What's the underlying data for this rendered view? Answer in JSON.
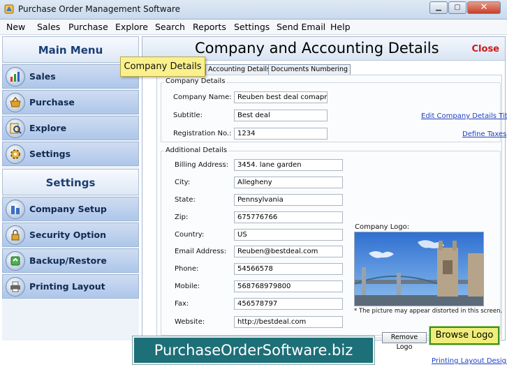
{
  "window": {
    "title": "Purchase Order Management Software",
    "min_glyph": "▁",
    "max_glyph": "▢",
    "close_glyph": "✕"
  },
  "menu": [
    "New",
    "Sales",
    "Purchase",
    "Explore",
    "Search",
    "Reports",
    "Settings",
    "Send Email",
    "Help"
  ],
  "sidebar": {
    "main_menu_title": "Main Menu",
    "main_items": [
      {
        "label": "Sales",
        "icon": "sales-chart-icon"
      },
      {
        "label": "Purchase",
        "icon": "purchase-basket-icon"
      },
      {
        "label": "Explore",
        "icon": "explore-icon"
      },
      {
        "label": "Settings",
        "icon": "settings-gear-icon"
      }
    ],
    "settings_title": "Settings",
    "settings_items": [
      {
        "label": "Company Setup",
        "icon": "company-setup-icon"
      },
      {
        "label": "Security Option",
        "icon": "lock-icon"
      },
      {
        "label": "Backup/Restore",
        "icon": "backup-restore-icon"
      },
      {
        "label": "Printing Layout",
        "icon": "printer-icon"
      }
    ]
  },
  "tooltip": "Company Details",
  "main": {
    "title": "Company and Accounting Details",
    "close_label": "Close",
    "tabs": [
      "Accounting Details",
      "Documents Numbering"
    ],
    "company_details": {
      "group_label": "Company Details",
      "fields": [
        {
          "label": "Company Name:",
          "value": "Reuben best deal comapny"
        },
        {
          "label": "Subtitle:",
          "value": "Best deal"
        },
        {
          "label": "Registration No.:",
          "value": "1234"
        }
      ],
      "edit_title_link": "Edit Company Details Title",
      "define_taxes_link": "Define Taxes"
    },
    "additional_details": {
      "group_label": "Additional Details",
      "fields": [
        {
          "label": "Billing Address:",
          "value": "3454. lane garden"
        },
        {
          "label": "City:",
          "value": "Allegheny"
        },
        {
          "label": "State:",
          "value": "Pennsylvania"
        },
        {
          "label": "Zip:",
          "value": "675776766"
        },
        {
          "label": "Country:",
          "value": "US"
        },
        {
          "label": "Email Address:",
          "value": "Reuben@bestdeal.com"
        },
        {
          "label": "Phone:",
          "value": "54566578"
        },
        {
          "label": "Mobile:",
          "value": "568768979800"
        },
        {
          "label": "Fax:",
          "value": "456578797"
        },
        {
          "label": "Website:",
          "value": "http://bestdeal.com"
        }
      ]
    },
    "logo": {
      "label": "Company Logo:",
      "note": "* The picture may appear distorted in this screen.",
      "remove_label": "Remove Logo",
      "browse_label": "Browse Logo"
    },
    "printing_layout_link": "Printing Layout Design"
  },
  "banner": "PurchaseOrderSoftware.biz",
  "colors": {
    "accent": "#1c3e72",
    "close_red": "#d01818",
    "link_blue": "#1e3fc0",
    "banner_teal": "#1d6f78",
    "browse_yellow": "#efee7a"
  }
}
